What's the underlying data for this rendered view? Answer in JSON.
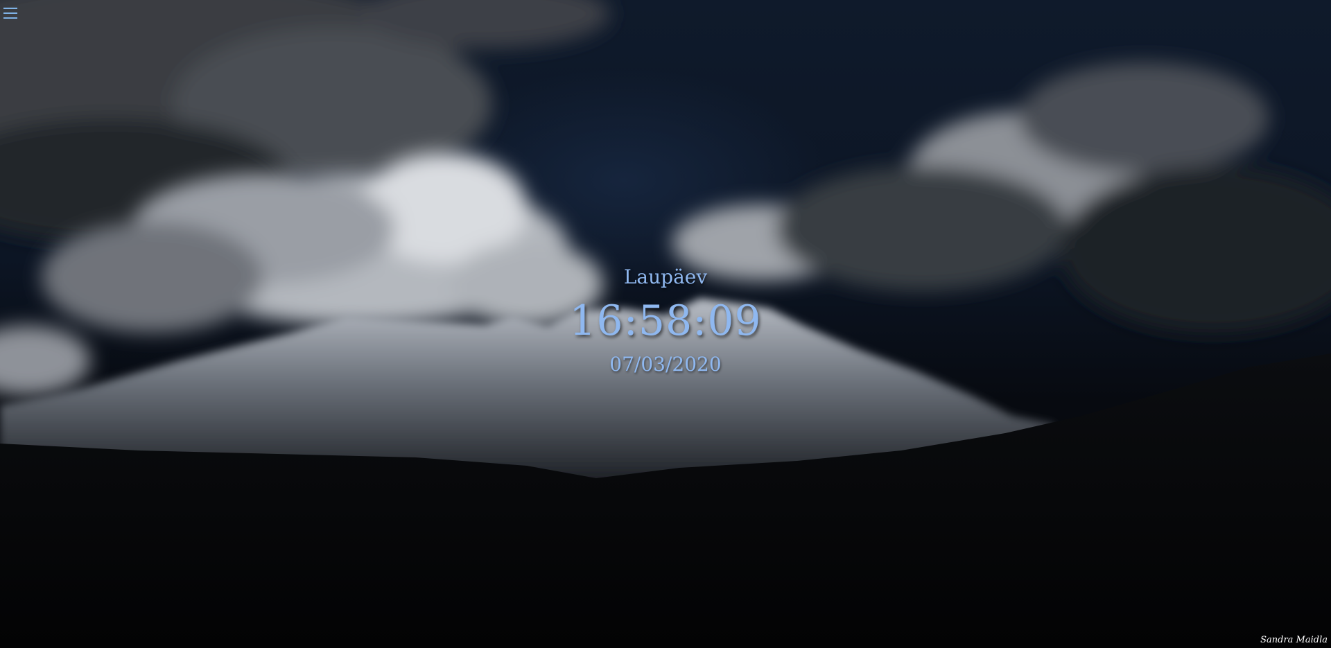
{
  "menu": {
    "icon": "hamburger-menu-icon",
    "color": "#7fb2e6"
  },
  "clock": {
    "day": "Laupäev",
    "time": "16:58:09",
    "date": "07/03/2020",
    "text_color": "#8fb8f0"
  },
  "credit": {
    "author": "Sandra Maidla"
  }
}
